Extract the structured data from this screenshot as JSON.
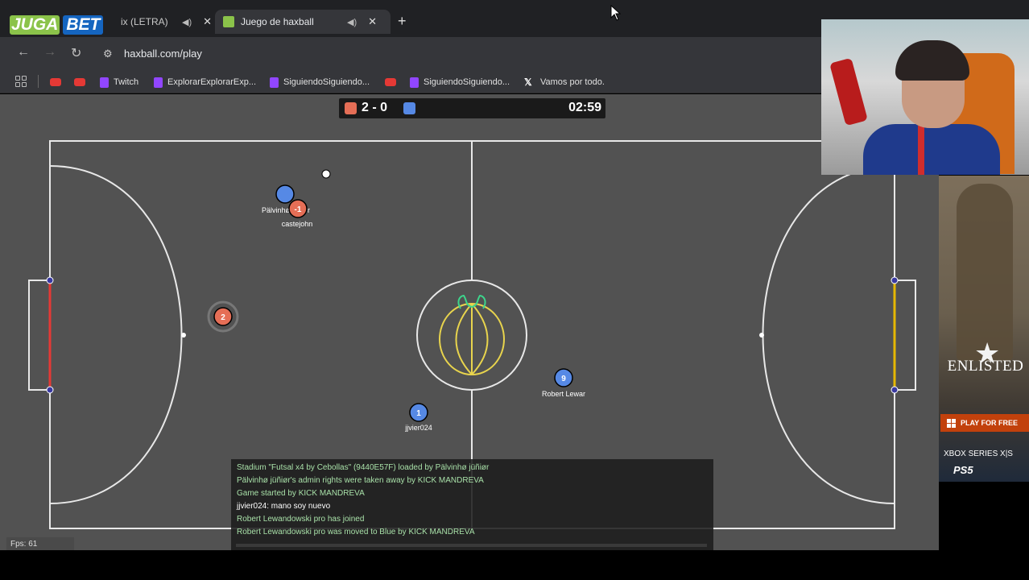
{
  "browser": {
    "brand_part1": "JUGA",
    "brand_part2": "BET",
    "tabs": [
      {
        "title": "ix (LETRA) J",
        "active": false
      },
      {
        "title": "Juego de haxball",
        "active": true
      }
    ],
    "new_tab_label": "+",
    "url": "haxball.com/play",
    "bookmarks": [
      {
        "label": "",
        "icon": "youtube-icon"
      },
      {
        "label": "",
        "icon": "youtube-icon"
      },
      {
        "label": "Twitch",
        "icon": "twitch-icon"
      },
      {
        "label": "ExplorarExplorarExp...",
        "icon": "twitch-icon"
      },
      {
        "label": "SiguiendoSiguiendo...",
        "icon": "twitch-icon"
      },
      {
        "label": "",
        "icon": "youtube-icon"
      },
      {
        "label": "SiguiendoSiguiendo...",
        "icon": "twitch-icon"
      },
      {
        "label": "Vamos por todo.",
        "icon": "x-icon"
      }
    ]
  },
  "game": {
    "score": "2 - 0",
    "time": "02:59",
    "colors": {
      "red": "#e56e56",
      "blue": "#5689e5",
      "pitch": "#525252",
      "line": "#c7e6bd"
    },
    "players": [
      {
        "team": "blue",
        "number": "",
        "name": "Pälvinhø jüñiør"
      },
      {
        "team": "red",
        "number": "-1",
        "name": "castejohn"
      },
      {
        "team": "red",
        "number": "2",
        "name": ""
      },
      {
        "team": "blue",
        "number": "9",
        "name": "Robert Lewar"
      },
      {
        "team": "blue",
        "number": "1",
        "name": "jjvier024"
      }
    ],
    "chat": [
      {
        "kind": "sys",
        "text": "Stadium \"Futsal x4 by Cebollas\" (9440E57F) loaded by Pälvinhø jüñiør"
      },
      {
        "kind": "sys",
        "text": "Pälvinhø jüñiør's admin rights were taken away by KICK MANDREVA"
      },
      {
        "kind": "sys",
        "text": "Game started by KICK MANDREVA"
      },
      {
        "kind": "msg",
        "text": "jjvier024: mano soy nuevo"
      },
      {
        "kind": "sys",
        "text": "Robert Lewandowski pro has joined"
      },
      {
        "kind": "sys",
        "text": "Robert Lewandowski pro was moved to Blue by KICK MANDREVA"
      }
    ],
    "fps": "Fps: 61"
  },
  "ad": {
    "title": "ENLISTED",
    "button": "PLAY FOR FREE",
    "platform1": "XBOX SERIES X|S",
    "platform2": "PS5"
  }
}
